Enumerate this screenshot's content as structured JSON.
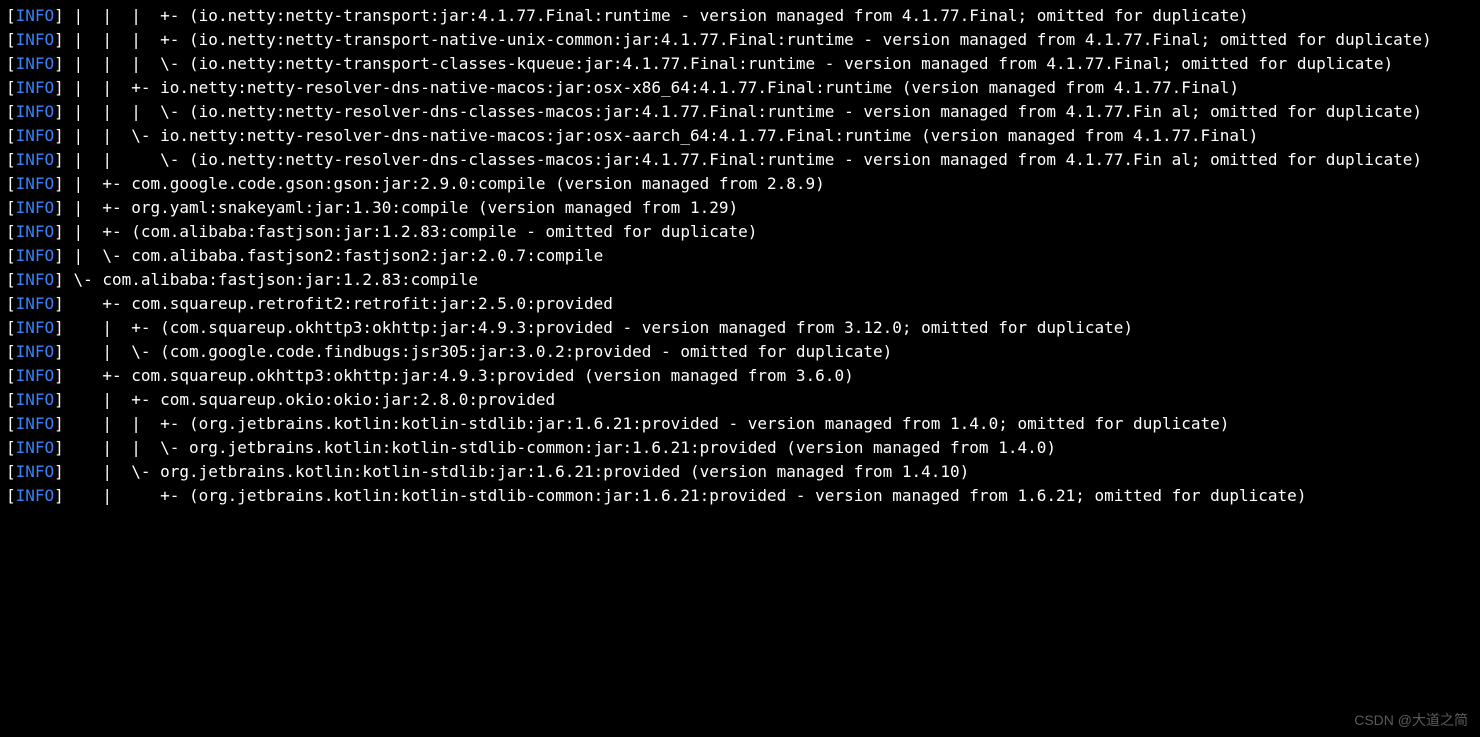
{
  "log_level": "INFO",
  "lines": [
    {
      "body": " |  |  |  +- (io.netty:netty-transport:jar:4.1.77.Final:runtime - version managed from 4.1.77.Final; omitted for duplicate)"
    },
    {
      "body": " |  |  |  +- (io.netty:netty-transport-native-unix-common:jar:4.1.77.Final:runtime - version managed from 4.1.77.Final; omitted for duplicate)"
    },
    {
      "body": " |  |  |  \\- (io.netty:netty-transport-classes-kqueue:jar:4.1.77.Final:runtime - version managed from 4.1.77.Final; omitted for duplicate)"
    },
    {
      "body": " |  |  +- io.netty:netty-resolver-dns-native-macos:jar:osx-x86_64:4.1.77.Final:runtime (version managed from 4.1.77.Final)"
    },
    {
      "body": " |  |  |  \\- (io.netty:netty-resolver-dns-classes-macos:jar:4.1.77.Final:runtime - version managed from 4.1.77.Fin al; omitted for duplicate)"
    },
    {
      "body": " |  |  \\- io.netty:netty-resolver-dns-native-macos:jar:osx-aarch_64:4.1.77.Final:runtime (version managed from 4.1.77.Final)"
    },
    {
      "body": " |  |     \\- (io.netty:netty-resolver-dns-classes-macos:jar:4.1.77.Final:runtime - version managed from 4.1.77.Fin al; omitted for duplicate)"
    },
    {
      "body": " |  +- com.google.code.gson:gson:jar:2.9.0:compile (version managed from 2.8.9)"
    },
    {
      "body": " |  +- org.yaml:snakeyaml:jar:1.30:compile (version managed from 1.29)"
    },
    {
      "body": " |  +- (com.alibaba:fastjson:jar:1.2.83:compile - omitted for duplicate)"
    },
    {
      "body": " |  \\- com.alibaba.fastjson2:fastjson2:jar:2.0.7:compile"
    },
    {
      "body": " \\- com.alibaba:fastjson:jar:1.2.83:compile"
    },
    {
      "body": "    +- com.squareup.retrofit2:retrofit:jar:2.5.0:provided"
    },
    {
      "body": "    |  +- (com.squareup.okhttp3:okhttp:jar:4.9.3:provided - version managed from 3.12.0; omitted for duplicate)"
    },
    {
      "body": "    |  \\- (com.google.code.findbugs:jsr305:jar:3.0.2:provided - omitted for duplicate)"
    },
    {
      "body": "    +- com.squareup.okhttp3:okhttp:jar:4.9.3:provided (version managed from 3.6.0)"
    },
    {
      "body": "    |  +- com.squareup.okio:okio:jar:2.8.0:provided"
    },
    {
      "body": "    |  |  +- (org.jetbrains.kotlin:kotlin-stdlib:jar:1.6.21:provided - version managed from 1.4.0; omitted for duplicate)"
    },
    {
      "body": "    |  |  \\- org.jetbrains.kotlin:kotlin-stdlib-common:jar:1.6.21:provided (version managed from 1.4.0)"
    },
    {
      "body": "    |  \\- org.jetbrains.kotlin:kotlin-stdlib:jar:1.6.21:provided (version managed from 1.4.10)"
    },
    {
      "body": "    |     +- (org.jetbrains.kotlin:kotlin-stdlib-common:jar:1.6.21:provided - version managed from 1.6.21; omitted for duplicate)"
    }
  ],
  "watermark": "CSDN @大道之简"
}
